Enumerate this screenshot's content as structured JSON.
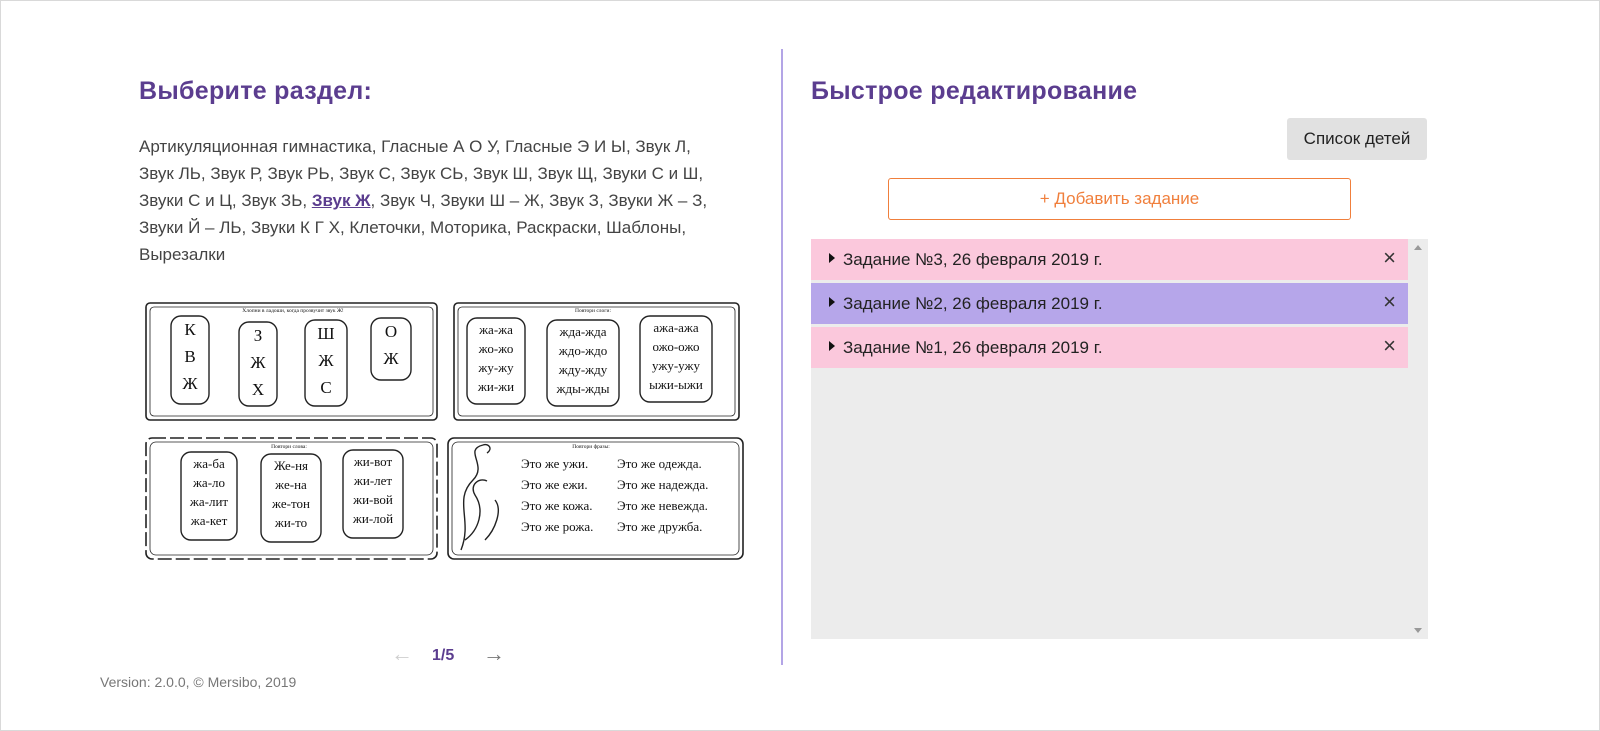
{
  "left": {
    "title": "Выберите раздел:",
    "sections": [
      {
        "label": "Артикуляционная гимнастика",
        "active": false
      },
      {
        "label": "Гласные А О У",
        "active": false
      },
      {
        "label": "Гласные Э И Ы",
        "active": false
      },
      {
        "label": "Звук Л",
        "active": false
      },
      {
        "label": "Звук ЛЬ",
        "active": false
      },
      {
        "label": "Звук Р",
        "active": false
      },
      {
        "label": "Звук РЬ",
        "active": false
      },
      {
        "label": "Звук С",
        "active": false
      },
      {
        "label": "Звук СЬ",
        "active": false
      },
      {
        "label": "Звук Ш",
        "active": false
      },
      {
        "label": "Звук Щ",
        "active": false
      },
      {
        "label": "Звуки С и Ш",
        "active": false
      },
      {
        "label": "Звуки С и Ц",
        "active": false
      },
      {
        "label": "Звук ЗЬ",
        "active": false
      },
      {
        "label": "Звук Ж",
        "active": true
      },
      {
        "label": "Звук Ч",
        "active": false
      },
      {
        "label": "Звуки Ш – Ж",
        "active": false
      },
      {
        "label": "Звук З",
        "active": false
      },
      {
        "label": "Звуки Ж – З",
        "active": false
      },
      {
        "label": "Звуки Й – ЛЬ",
        "active": false
      },
      {
        "label": "Звуки К Г Х",
        "active": false
      },
      {
        "label": "Клеточки",
        "active": false
      },
      {
        "label": "Моторика",
        "active": false
      },
      {
        "label": "Раскраски",
        "active": false
      },
      {
        "label": "Шаблоны",
        "active": false
      },
      {
        "label": "Вырезалки",
        "active": false
      }
    ],
    "worksheet": {
      "p1": {
        "heading": "Хлопни в ладоши, когда прозвучит звук Ж!",
        "bubbles": [
          [
            "К",
            "В",
            "Ж"
          ],
          [
            "З",
            "Ж",
            "Х"
          ],
          [
            "Ш",
            "Ж",
            "С"
          ],
          [
            "О",
            "Ж"
          ]
        ]
      },
      "p2": {
        "heading": "Повтори слоги:",
        "bubbles": [
          [
            "жа-жа",
            "жо-жо",
            "жу-жу",
            "жи-жи"
          ],
          [
            "жда-жда",
            "ждо-ждо",
            "жду-жду",
            "жды-жды"
          ],
          [
            "ажа-ажа",
            "ожо-ожо",
            "ужу-ужу",
            "ыжи-ыжи"
          ]
        ]
      },
      "p3": {
        "heading": "Повтори слова:",
        "bubbles": [
          [
            "жа-ба",
            "жа-ло",
            "жа-лит",
            "жа-кет"
          ],
          [
            "Же-ня",
            "же-на",
            "же-тон",
            "жи-то"
          ],
          [
            "жи-вот",
            "жи-лет",
            "жи-вой",
            "жи-лой"
          ]
        ]
      },
      "p4": {
        "heading": "Повтори фразы:",
        "lines": [
          [
            "Это же ужи.",
            "Это же одежда."
          ],
          [
            "Это же ежи.",
            "Это же надежда."
          ],
          [
            "Это же кожа.",
            "Это же невежда."
          ],
          [
            "Это же рожа.",
            "Это же дружба."
          ]
        ]
      }
    },
    "pager": {
      "prev_icon": "←",
      "next_icon": "→",
      "label": "1/5"
    },
    "version": "Version: 2.0.0, © Mersibo, 2019"
  },
  "right": {
    "title": "Быстрое редактирование",
    "kids_button": "Список детей",
    "add_button": "+ Добавить задание",
    "tasks": [
      {
        "label": "Задание №3, 26 февраля 2019 г.",
        "color": "#fbc8dc"
      },
      {
        "label": "Задание №2, 26 февраля 2019 г.",
        "color": "#b6a6ea"
      },
      {
        "label": "Задание №1, 26 февраля 2019 г.",
        "color": "#fbc8dc"
      }
    ],
    "close_icon": "×"
  },
  "colors": {
    "accent": "#5b3d8f",
    "divider": "#b3a5e6",
    "add_button": "#f07f3c"
  }
}
